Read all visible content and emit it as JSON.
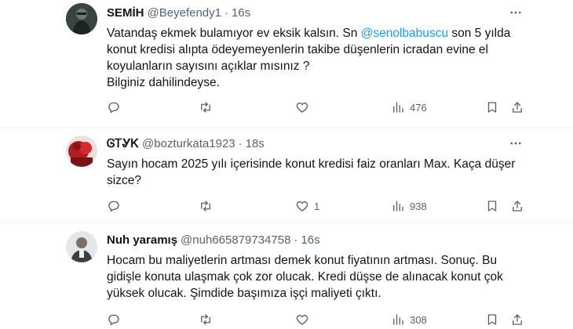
{
  "tweets": [
    {
      "name": "SEMİH",
      "handle": "@Beyefendy1",
      "separator": "·",
      "time": "16s",
      "text": {
        "l1_before": "Vatandaş ekmek bulamıyor ev eksik kalsın. Sn ",
        "mention": "@senolbabuscu",
        "l1_after": "  son 5 yılda",
        "l2": "konut kredisi alıpta ödeyemeyenlerin takibe düşenlerin icradan evine el",
        "l3": "koyulanların sayısını açıklar mısınız ?",
        "l4": "Bilginiz dahilindeyse."
      },
      "views": "476"
    },
    {
      "name": "ᎶᎢᎽᏦ",
      "handle": "@bozturkata1923",
      "separator": "·",
      "time": "18s",
      "text": {
        "l1": "Sayın hocam 2025 yılı içerisinde konut kredisi faiz oranları Max. Kaça düşer",
        "l2": "sizce?"
      },
      "likes": "1",
      "views": "938"
    },
    {
      "name": "Nuh yaramış",
      "handle": "@nuh665879734758",
      "separator": "·",
      "time": "16s",
      "text": {
        "l1": "Hocam bu maliyetlerin artması demek konut fiyatının artması. Sonuç. Bu",
        "l2": "gidişle konuta ulaşmak çok zor olucak. Kredi düşse de alınacak konut çok",
        "l3": "yüksek olucak. Şimdide başımıza işçi maliyeti çıktı."
      },
      "views": "308"
    }
  ],
  "icons": {
    "more": "more-horizontal-icon",
    "reply": "reply-icon",
    "retweet": "retweet-icon",
    "like": "heart-icon",
    "views": "views-chart-icon",
    "bookmark": "bookmark-icon",
    "share": "share-icon"
  },
  "colors": {
    "text": "#0f1419",
    "secondary": "#536471",
    "mention": "#1d9bf0",
    "divider": "#eff3f4"
  }
}
